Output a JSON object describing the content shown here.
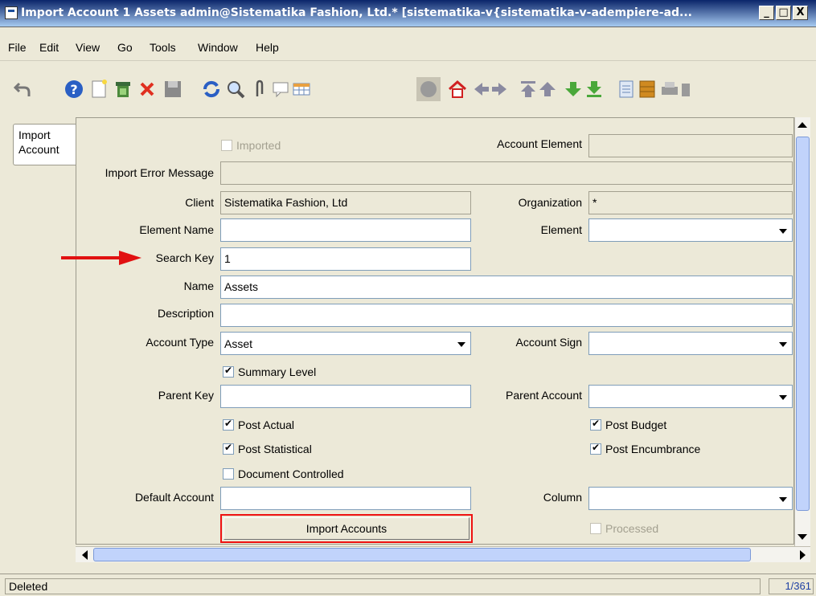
{
  "window": {
    "title": "Import Account  1  Assets  admin@Sistematika Fashion, Ltd.* [sistematika-v{sistematika-v-adempiere-ad..."
  },
  "menu": [
    {
      "label": "File"
    },
    {
      "label": "Edit"
    },
    {
      "label": "View"
    },
    {
      "label": "Go"
    },
    {
      "label": "Tools"
    },
    {
      "label": "Window"
    },
    {
      "label": "Help"
    }
  ],
  "tabs": [
    {
      "label": "Import\nAccount"
    }
  ],
  "form": {
    "imported_label": "Imported",
    "account_element_label": "Account Element",
    "import_error_label": "Import Error Message",
    "client_label": "Client",
    "client_value": "Sistematika Fashion, Ltd",
    "organization_label": "Organization",
    "organization_value": "*",
    "element_name_label": "Element Name",
    "element_label": "Element",
    "search_key_label": "Search Key",
    "search_key_value": "1",
    "name_label": "Name",
    "name_value": "Assets",
    "description_label": "Description",
    "account_type_label": "Account Type",
    "account_type_value": "Asset",
    "account_sign_label": "Account Sign",
    "summary_level_label": "Summary Level",
    "parent_key_label": "Parent Key",
    "parent_account_label": "Parent Account",
    "post_actual_label": "Post Actual",
    "post_budget_label": "Post Budget",
    "post_statistical_label": "Post Statistical",
    "post_encumbrance_label": "Post Encumbrance",
    "document_controlled_label": "Document Controlled",
    "default_account_label": "Default Account",
    "column_label": "Column",
    "import_button_label": "Import Accounts",
    "processed_label": "Processed"
  },
  "status": {
    "text": "Deleted",
    "record_count": "1/361"
  },
  "colors": {
    "highlight_red": "#e11111",
    "title_bar": "#0a246a"
  }
}
